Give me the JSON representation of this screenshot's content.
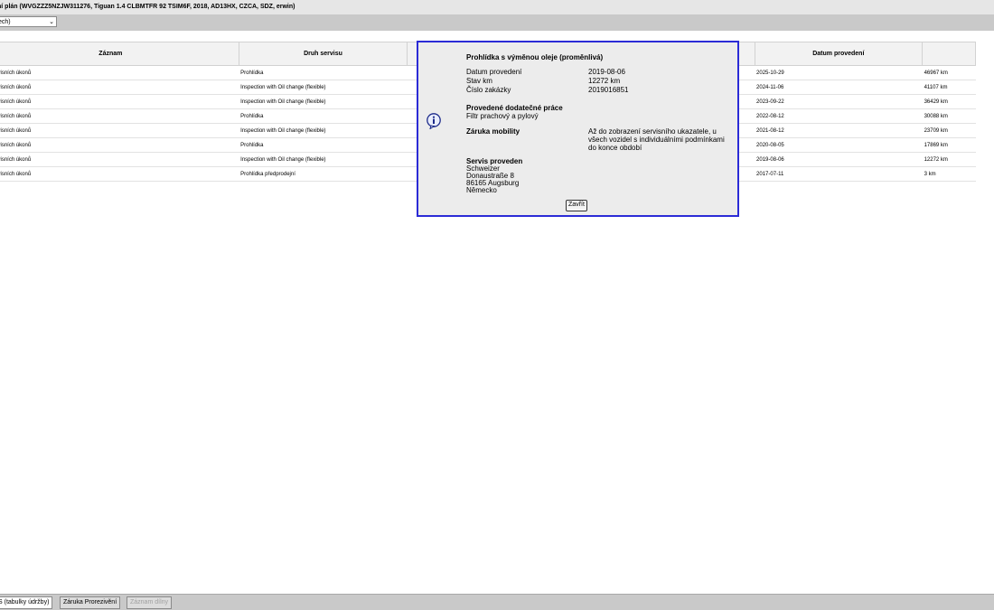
{
  "window": {
    "title": "ní plán (WVGZZZ5NZJW311276, Tiguan 1.4 CLBMTFR 92 TSIM6F, 2018, AD13HX, CZCA, SDZ, erwin)"
  },
  "toolbar": {
    "select_value": "ech)"
  },
  "table": {
    "headers": [
      "Záznam",
      "Druh servisu",
      "",
      "Datum provedení",
      ""
    ],
    "rows": [
      {
        "record": "ní servisních úkonů",
        "type": "Prohlídka",
        "date": "2025-10-29",
        "km": "46967 km"
      },
      {
        "record": "ní servisních úkonů",
        "type": "Inspection with Oil change (flexible)",
        "date": "2024-11-06",
        "km": "41107 km"
      },
      {
        "record": "ní servisních úkonů",
        "type": "Inspection with Oil change (flexible)",
        "date": "2023-09-22",
        "km": "36429 km"
      },
      {
        "record": "ní servisních úkonů",
        "type": "Prohlídka",
        "date": "2022-08-12",
        "km": "30088 km"
      },
      {
        "record": "ní servisních úkonů",
        "type": "Inspection with Oil change (flexible)",
        "date": "2021-08-12",
        "km": "23709 km"
      },
      {
        "record": "ní servisních úkonů",
        "type": "Prohlídka",
        "date": "2020-08-05",
        "km": "17869 km"
      },
      {
        "record": "ní servisních úkonů",
        "type": "Inspection with Oil change (flexible)",
        "date": "2019-08-06",
        "km": "12272 km"
      },
      {
        "record": "ní servisních úkonů",
        "type": "Prohlídka předprodejní",
        "date": "2017-07-11",
        "km": "3 km"
      }
    ]
  },
  "dialog": {
    "title": "Prohlídka s výměnou oleje (proměnlivá)",
    "date_label": "Datum provedení",
    "date_value": "2019-08-06",
    "km_label": "Stav km",
    "km_value": "12272 km",
    "order_label": "Číslo zakázky",
    "order_value": "2019016851",
    "extra_work_heading": "Provedené dodatečné práce",
    "extra_work_item": "Filtr prachový a pylový",
    "mobility_label": "Záruka mobility",
    "mobility_value": "Až do zobrazení servisního ukazatele, u všech vozidel s individuálními podmínkami do konce období",
    "service_heading": "Servis proveden",
    "service_name": "Schweizer",
    "service_street": "Donaustraße 8",
    "service_city": "86165 Augsburg",
    "service_country": "Německo",
    "close_label": "Zavřít",
    "icon": "info-icon",
    "border_color": "#2b2bd6"
  },
  "tabs": [
    {
      "label": "S (tabulky údržby)",
      "state": "active"
    },
    {
      "label": "Záruka Prorezivění",
      "state": "normal"
    },
    {
      "label": "Záznam dílny",
      "state": "disabled"
    }
  ]
}
